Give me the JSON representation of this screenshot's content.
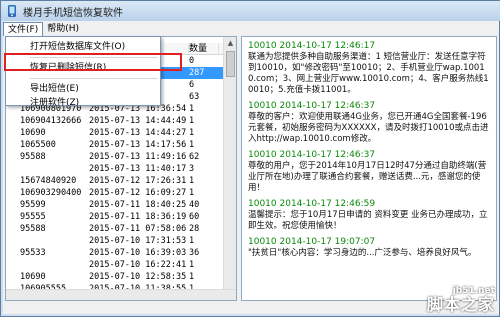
{
  "window": {
    "title": "楼月手机短信恢复软件"
  },
  "menubar": {
    "items": [
      "文件(F)",
      "帮助(H)"
    ]
  },
  "file_menu": {
    "items": [
      "打开短信数据库文件(O)",
      "恢复已删除短信(R)",
      "导出短信(E)",
      "注册软件(Z)"
    ]
  },
  "list": {
    "headers": [
      "",
      "",
      "数量"
    ],
    "rows": [
      {
        "number": "",
        "date": "",
        "count": "0"
      },
      {
        "number": "",
        "date": ":36",
        "count": "287"
      },
      {
        "number": "",
        "date": "",
        "count": "6"
      },
      {
        "number": "",
        "date": "",
        "count": "63"
      },
      {
        "number": "106900801970",
        "date": "2015-07-13 16:36:54",
        "count": "1"
      },
      {
        "number": "106904132666",
        "date": "2015-07-13 14:44:49",
        "count": "1"
      },
      {
        "number": "10690",
        "date": "2015-07-13 14:44:27",
        "count": "1"
      },
      {
        "number": "1065500",
        "date": "2015-07-13 14:17:56",
        "count": "1"
      },
      {
        "number": "95588",
        "date": "2015-07-13 11:49:16",
        "count": "62"
      },
      {
        "number": "",
        "date": "2015-07-13 11:40:17",
        "count": "3"
      },
      {
        "number": "15674840920",
        "date": "2015-07-12 17:26:31",
        "count": "1"
      },
      {
        "number": "106903290400",
        "date": "2015-07-12 16:09:27",
        "count": "1"
      },
      {
        "number": "95599",
        "date": "2015-07-11 18:40:25",
        "count": "40"
      },
      {
        "number": "95555",
        "date": "2015-07-11 18:36:19",
        "count": "60"
      },
      {
        "number": "95588",
        "date": "2015-07-11 07:58:06",
        "count": "28"
      },
      {
        "number": "",
        "date": "2015-07-10 17:31:53",
        "count": "1"
      },
      {
        "number": "95533",
        "date": "2015-07-10 16:39:03",
        "count": "36"
      },
      {
        "number": "",
        "date": "2015-07-10 16:22:41",
        "count": "1"
      },
      {
        "number": "10690",
        "date": "2015-07-10 12:58:35",
        "count": "1"
      },
      {
        "number": "106905555",
        "date": "2015-07-10 11:38:55",
        "count": "1"
      },
      {
        "number": "106",
        "date": "2015-07-10 11:21:09",
        "count": "1"
      },
      {
        "number": "106",
        "date": "2015-07-10 09:57:20",
        "count": "1"
      }
    ]
  },
  "messages": [
    {
      "header": "10010 2014-10-17 12:46:17",
      "body": "联通为您提供多种自助服务渠道：1 短信营业厅：发送任意字符到10010，如\"修改密码\"至10010；2、手机营业厅wap.10010.com；3、网上营业厅www.10010.com；4、客户服务热线10010；5.充值卡拨11001。"
    },
    {
      "header": "10010 2014-10-17 12:46:37",
      "body": "尊敬的客户：欢迎使用联通4G业务，您已开通4G全国套餐-196元套餐，初始服务密码为XXXXXX，请及时拨打10010或点击进入http://wap.10010.com修改。"
    },
    {
      "header": "10010 2014-10-17 12:46:37",
      "body": "尊敬的用户，您于2014年10月17日12时47分通过自助终端(营业厅所在地)办理了联通合约套餐，赠送话费...元，感谢您的使用！"
    },
    {
      "header": "10010 2014-10-17 12:46:59",
      "body": "温馨提示：您于10月17日申请的 资料变更 业务已办理成功，立即生效。祝您使用愉快！"
    },
    {
      "header": "10010 2014-10-17 19:07:07",
      "body": "\"扶贫日\"核心内容：学习身边的...广泛参与、培养良好风气。"
    }
  ],
  "watermark": {
    "top": "jb51.net",
    "main": "脚本之家"
  },
  "colors": {
    "selection": "#3399ff",
    "highlight_border": "#e02020",
    "msg_header": "#0a8a0a"
  }
}
